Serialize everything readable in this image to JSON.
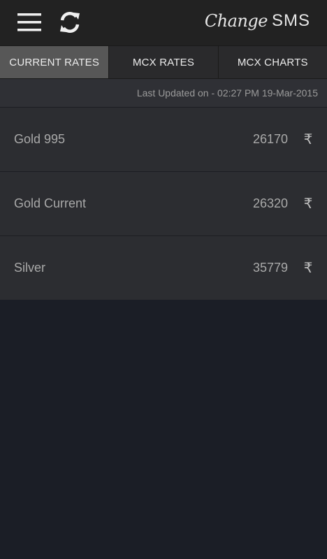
{
  "header": {
    "logo_script": "Change",
    "logo_text": "SMS"
  },
  "tabs": [
    {
      "label": "CURRENT RATES",
      "active": true
    },
    {
      "label": "MCX RATES",
      "active": false
    },
    {
      "label": "MCX CHARTS",
      "active": false
    }
  ],
  "last_updated": "Last Updated on - 02:27 PM 19-Mar-2015",
  "rates": [
    {
      "name": "Gold 995",
      "value": "26170",
      "currency": "₹"
    },
    {
      "name": "Gold Current",
      "value": "26320",
      "currency": "₹"
    },
    {
      "name": "Silver",
      "value": "35779",
      "currency": "₹"
    }
  ],
  "colors": {
    "topbar": "#222222",
    "active_tab": "#575757",
    "row_bg": "#2c2d31",
    "page_bg": "#1b1e26"
  }
}
